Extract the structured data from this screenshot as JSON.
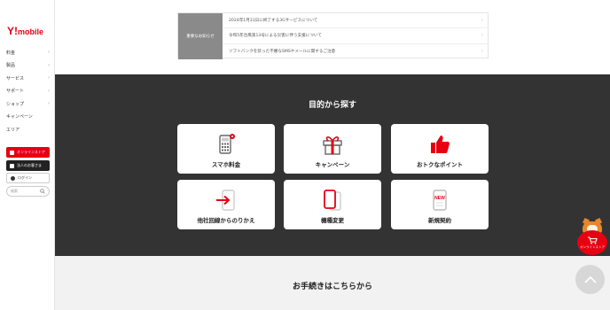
{
  "brand": {
    "logo_y": "Y!",
    "logo_word": "mobile",
    "color": "#e60012"
  },
  "sidebar": {
    "items": [
      {
        "label": "料金",
        "has_chevron": true
      },
      {
        "label": "製品",
        "has_chevron": true
      },
      {
        "label": "サービス",
        "has_chevron": true
      },
      {
        "label": "サポート",
        "has_chevron": true
      },
      {
        "label": "ショップ",
        "has_chevron": true
      },
      {
        "label": "キャンペーン",
        "has_chevron": false
      },
      {
        "label": "エリア",
        "has_chevron": false
      }
    ],
    "online_store": "オンラインストア",
    "corporate": "法人のお客さま",
    "login": "ログイン",
    "search_placeholder": "検索"
  },
  "notice": {
    "label": "重要なお知らせ",
    "items": [
      "2024年1月31日に終了する3Gサービスについて",
      "令和5年台風第13号による災害に伴う支援について",
      "ソフトバンクを装った不審なSMSやメールに関するご注意"
    ]
  },
  "purpose": {
    "title": "目的から探す",
    "cards": [
      {
        "label": "スマホ料金",
        "icon": "calculator-icon"
      },
      {
        "label": "キャンペーン",
        "icon": "gift-icon"
      },
      {
        "label": "おトクなポイント",
        "icon": "thumbs-up-icon"
      },
      {
        "label": "他社回線からのりかえ",
        "icon": "switch-phone-icon"
      },
      {
        "label": "機種変更",
        "icon": "phones-icon"
      },
      {
        "label": "新規契約",
        "icon": "new-phone-icon",
        "badge": "NEW"
      }
    ]
  },
  "procedures": {
    "title": "お手続きはこちらから"
  },
  "floating": {
    "store_label": "オンラインストア",
    "top_icon": "arrow-up-icon"
  }
}
